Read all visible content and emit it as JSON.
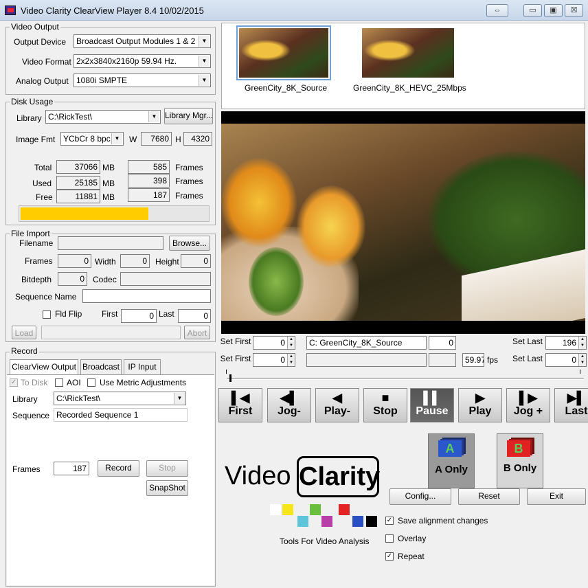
{
  "window": {
    "title": "Video Clarity ClearView Player 8.4 10/02/2015",
    "buttons": {
      "swap": "⇔",
      "minimize": "▭",
      "maximize": "▣",
      "close": "☒"
    }
  },
  "video_output": {
    "title": "Video Output",
    "output_device_label": "Output Device",
    "output_device": "Broadcast Output Modules 1 & 2",
    "video_format_label": "Video Format",
    "video_format": "2x2x3840x2160p 59.94 Hz.",
    "analog_output_label": "Analog Output",
    "analog_output": "1080i SMPTE"
  },
  "disk_usage": {
    "title": "Disk Usage",
    "library_label": "Library",
    "library": "C:\\RickTest\\",
    "library_mgr": "Library Mgr...",
    "image_fmt_label": "Image Fmt",
    "image_fmt": "YCbCr 8 bpc",
    "w_label": "W",
    "w": "7680",
    "h_label": "H",
    "h": "4320",
    "total_label": "Total",
    "total_mb": "37066",
    "total_frames": "585",
    "used_label": "Used",
    "used_mb": "25185",
    "used_frames": "398",
    "free_label": "Free",
    "free_mb": "11881",
    "free_frames": "187",
    "mb": "MB",
    "frames": "Frames",
    "usage_fraction": 0.68,
    "bar_color": "#ffcc00"
  },
  "file_import": {
    "title": "File Import",
    "filename_label": "Filename",
    "filename": "",
    "browse": "Browse...",
    "frames_label": "Frames",
    "frames": "0",
    "width_label": "Width",
    "width": "0",
    "height_label": "Height",
    "height": "0",
    "bitdepth_label": "Bitdepth",
    "bitdepth": "0",
    "codec_label": "Codec",
    "codec": "",
    "sequence_name_label": "Sequence Name",
    "sequence_name": "",
    "fld_flip_label": "Fld Flip",
    "first_label": "First",
    "first": "0",
    "last_label": "Last",
    "last": "0",
    "load": "Load",
    "abort": "Abort"
  },
  "record": {
    "title": "Record",
    "tabs": [
      "ClearView Output",
      "Broadcast",
      "IP Input"
    ],
    "to_disk": "To Disk",
    "aoi": "AOI",
    "metric": "Use Metric Adjustments",
    "library_label": "Library",
    "library": "C:\\RickTest\\",
    "sequence_label": "Sequence",
    "sequence": "Recorded Sequence 1",
    "frames_label": "Frames",
    "frames": "187",
    "record": "Record",
    "stop": "Stop",
    "snapshot": "SnapShot"
  },
  "thumbnails": [
    {
      "label": "GreenCity_8K_Source"
    },
    {
      "label": "GreenCity_8K_HEVC_25Mbps"
    }
  ],
  "controls": {
    "set_first": "Set First",
    "set_last": "Set Last",
    "first_a": "0",
    "first_b": "0",
    "clip_name": "C: GreenCity_8K_Source",
    "frame": "0",
    "last_a": "196",
    "last_b": "0",
    "fps": "59.97",
    "fps_label": "fps"
  },
  "transport": [
    {
      "name": "first",
      "glyph": "▌◀",
      "label": "First"
    },
    {
      "name": "jog-back",
      "glyph": "◀▌",
      "label": "Jog-"
    },
    {
      "name": "play-back",
      "glyph": "◀",
      "label": "Play-"
    },
    {
      "name": "stop",
      "glyph": "■",
      "label": "Stop"
    },
    {
      "name": "pause",
      "glyph": "▌▌",
      "label": "Pause"
    },
    {
      "name": "play",
      "glyph": "▶",
      "label": "Play"
    },
    {
      "name": "jog-forward",
      "glyph": "▌▶",
      "label": "Jog +"
    },
    {
      "name": "last",
      "glyph": "▶▌",
      "label": "Last"
    }
  ],
  "ab": {
    "a_letter": "A",
    "a_label": "A Only",
    "b_letter": "B",
    "b_label": "B Only",
    "a_color": "#2a57c9",
    "b_color": "#e22222"
  },
  "brand": {
    "video": "Video",
    "clarity": "Clarity",
    "tagline": "Tools For Video Analysis"
  },
  "settings": {
    "config": "Config...",
    "reset": "Reset",
    "exit": "Exit",
    "save_alignment": "Save alignment changes",
    "overlay": "Overlay",
    "repeat": "Repeat"
  }
}
